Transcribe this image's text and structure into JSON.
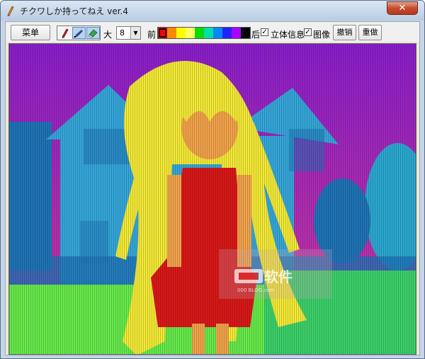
{
  "window": {
    "title": "チクワしか持ってねえ ver.4",
    "close_label": "✕"
  },
  "toolbar": {
    "menu_label": "菜单",
    "size_label": "大",
    "size_value": "8",
    "front_label": "前",
    "back_label": "后",
    "stereo_label": "立体信息",
    "stereo_checked": true,
    "image_label": "图像",
    "image_checked": true,
    "undo_label": "撤销",
    "redo_label": "重做",
    "palette": [
      "#ff0000",
      "#ff8800",
      "#ffff00",
      "#ffff66",
      "#00dd00",
      "#00ddaa",
      "#0088ff",
      "#2222ff",
      "#aa00ff",
      "#000000"
    ],
    "tools": [
      "pencil-icon",
      "brush-icon",
      "eraser-icon"
    ]
  },
  "canvas": {
    "watermark_main": "软件",
    "watermark_sub": "000 BLOG.com",
    "colors": {
      "sky_top": "#8a1ecc",
      "sky_bottom": "#d03a9a",
      "house": "#35a6d8",
      "house_dark": "#1f73b5",
      "trees": "#2aa8d0",
      "grass": "#66e84a",
      "field": "#3ccf6a",
      "hair": "#f2e836",
      "skin": "#f0a24a",
      "dress": "#d81818"
    }
  }
}
